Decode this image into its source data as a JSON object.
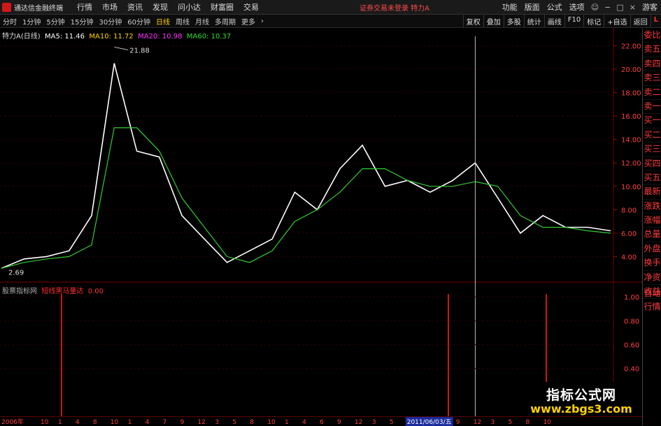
{
  "app": {
    "title": "通达信金融终端",
    "menu": [
      "行情",
      "市场",
      "资讯",
      "发现",
      "问小达",
      "财富圈",
      "交易"
    ],
    "login_note": "证券交易未登录  特力A",
    "right_menu": [
      "功能",
      "版面",
      "公式",
      "选项"
    ],
    "guest": "游客"
  },
  "toolbar": {
    "periods": [
      "分时",
      "1分钟",
      "5分钟",
      "15分钟",
      "30分钟",
      "60分钟",
      "日线",
      "周线",
      "月线",
      "多周期",
      "更多"
    ],
    "active_period": "日线",
    "tools": [
      "复权",
      "叠加",
      "多股",
      "统计",
      "画线",
      "F10",
      "标记",
      "+自选",
      "返回"
    ],
    "corner": "L"
  },
  "main_info": {
    "title": "特力A(日线)",
    "ma5": "MA5: 11.46",
    "ma10": "MA10: 11.72",
    "ma20": "MA20: 10.98",
    "ma60": "MA60: 10.37"
  },
  "indicator_info": {
    "source": "股票指标网",
    "name": "短线黑马量达",
    "value": "0.00"
  },
  "price_axis": {
    "ticks": [
      "22.00",
      "20.00",
      "18.00",
      "16.00",
      "14.00",
      "12.00",
      "10.00",
      "8.00",
      "6.00",
      "4.00"
    ],
    "high_label": "21.88",
    "low_label": "2.69"
  },
  "indicator_axis": {
    "ticks": [
      "1.00",
      "0.80",
      "0.60",
      "0.40"
    ]
  },
  "date_axis": {
    "start": "2006年",
    "labels": [
      "10",
      "1",
      "4",
      "8",
      "10",
      "1",
      "4",
      "7",
      "9",
      "12",
      "3",
      "5",
      "8",
      "10",
      "1",
      "4",
      "6",
      "9",
      "12",
      "3",
      "5",
      "2011/06/03/五",
      "9",
      "12",
      "3",
      "5",
      "8",
      "10"
    ],
    "cursor_date": "2011/06/03/五"
  },
  "sidebar": {
    "items": [
      "委比",
      "卖五",
      "卖四",
      "卖三",
      "卖二",
      "卖一",
      "买一",
      "买二",
      "买三",
      "买四",
      "买五",
      "最新",
      "涨跌",
      "涨幅",
      "总量",
      "外盘",
      "换手",
      "净资",
      "收益"
    ],
    "auto": [
      "自动",
      "行情"
    ]
  },
  "watermark": {
    "line1": "指标公式网",
    "line2": "www.zbgs3.com"
  },
  "chart_data": {
    "type": "line",
    "title": "特力A(日线)",
    "ylim": [
      2,
      22.8
    ],
    "x": [
      "2006",
      "2006-10",
      "2007-01",
      "2007-04",
      "2007-08",
      "2007-10",
      "2008-01",
      "2008-04",
      "2008-07",
      "2008-09",
      "2008-12",
      "2009-03",
      "2009-05",
      "2009-08",
      "2009-10",
      "2010-01",
      "2010-04",
      "2010-06",
      "2010-09",
      "2010-12",
      "2011-03",
      "2011-06",
      "2011-09",
      "2011-12",
      "2012-03",
      "2012-05",
      "2012-08",
      "2012-10"
    ],
    "series": [
      {
        "name": "MA5",
        "values": [
          3.0,
          3.8,
          4.0,
          4.5,
          7.5,
          20.5,
          13.0,
          12.5,
          7.5,
          5.5,
          3.5,
          4.5,
          5.5,
          9.5,
          8.0,
          11.5,
          13.5,
          10.0,
          10.5,
          9.5,
          10.5,
          12.0,
          9.0,
          6.0,
          7.5,
          6.5,
          6.5,
          6.2
        ]
      },
      {
        "name": "MA60",
        "values": [
          3.0,
          3.5,
          3.8,
          4.0,
          5.0,
          15.0,
          15.0,
          13.0,
          9.0,
          6.5,
          4.0,
          3.5,
          4.5,
          7.0,
          8.0,
          9.5,
          11.5,
          11.5,
          10.5,
          10.0,
          10.0,
          10.4,
          10.0,
          7.5,
          6.5,
          6.5,
          6.2,
          6.0
        ]
      }
    ],
    "indicator": {
      "name": "短线黑马量达",
      "signal_positions": [
        "2006-12",
        "2011-08",
        "2012-05"
      ],
      "signal_values": [
        1.0,
        1.0,
        1.0
      ],
      "ylim": [
        0,
        1.1
      ]
    },
    "cursor_x": "2011-06-03"
  }
}
